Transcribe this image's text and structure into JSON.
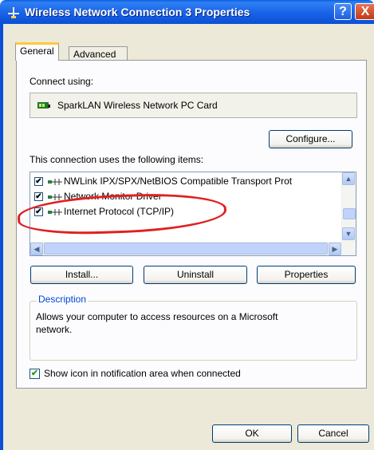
{
  "window": {
    "title": "Wireless Network Connection 3 Properties",
    "help_label": "?",
    "close_label": "X"
  },
  "tabs": [
    {
      "label": "General",
      "selected": true
    },
    {
      "label": "Advanced",
      "selected": false
    }
  ],
  "connect_using": {
    "label": "Connect using:",
    "adapter": "SparkLAN Wireless Network PC Card",
    "configure_button": "Configure..."
  },
  "items_section": {
    "label": "This connection uses the following items:",
    "items": [
      {
        "label": "NWLink IPX/SPX/NetBIOS Compatible Transport Prot",
        "checked": true
      },
      {
        "label": "Network Monitor Driver",
        "checked": true
      },
      {
        "label": "Internet Protocol (TCP/IP)",
        "checked": true
      }
    ]
  },
  "actions": {
    "install": "Install...",
    "uninstall": "Uninstall",
    "properties": "Properties"
  },
  "description": {
    "legend": "Description",
    "text_line1": "Allows your computer to access resources on a Microsoft",
    "text_line2": "network."
  },
  "notification": {
    "label": "Show icon in notification area when connected",
    "checked": true
  },
  "footer": {
    "ok": "OK",
    "cancel": "Cancel"
  },
  "colors": {
    "title_bar": "#0b50d6",
    "annotation": "#e02020",
    "legend": "#0046d5"
  }
}
